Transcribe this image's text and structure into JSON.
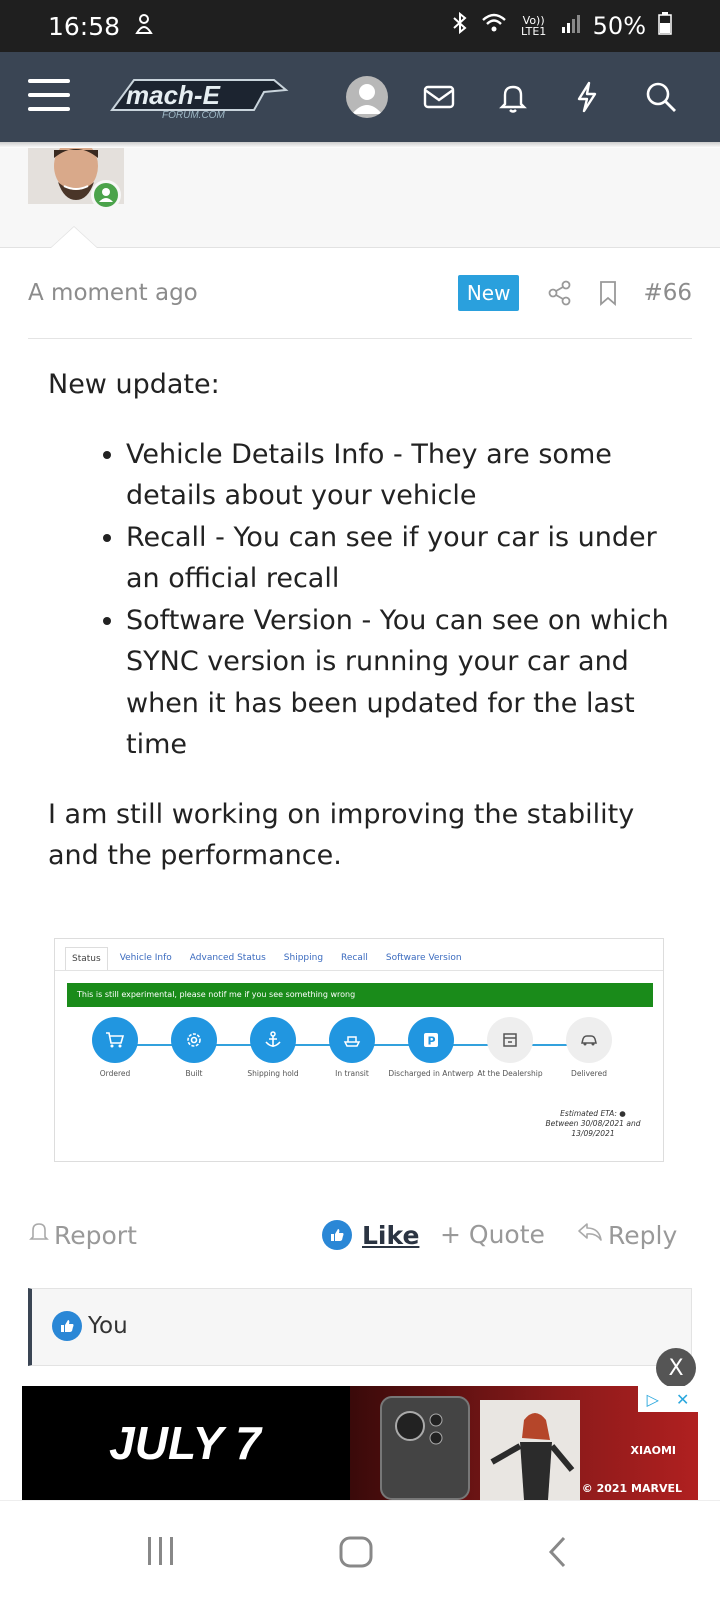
{
  "status_bar": {
    "time": "16:58",
    "battery": "50%",
    "volte": "Vo)) LTE1"
  },
  "header": {
    "logo_text": "mach-E",
    "logo_sub": "FORUM.COM"
  },
  "post": {
    "time": "A moment ago",
    "badge": "New",
    "number": "#66",
    "intro": "New update:",
    "bullets": [
      "Vehicle Details Info - They are some details about your vehicle",
      "Recall - You can see if your car is under an official recall",
      "Software Version - You can see on which SYNC version is running your car and when it has been updated for the last time"
    ],
    "closing": "I am still working on improving the stability and the performance."
  },
  "embed": {
    "tabs": [
      "Status",
      "Vehicle Info",
      "Advanced Status",
      "Shipping",
      "Recall",
      "Software Version"
    ],
    "banner": "This is still experimental, please notif me if you see something wrong",
    "steps": [
      "Ordered",
      "Built",
      "Shipping hold",
      "In transit",
      "Discharged in Antwerp",
      "At the Dealership",
      "Delivered"
    ],
    "eta_label": "Estimated ETA:",
    "eta_text": "Between 30/08/2021 and 13/09/2021"
  },
  "actions": {
    "report": "Report",
    "like": "Like",
    "quote": "+ Quote",
    "reply": "Reply"
  },
  "reactions": {
    "user": "You"
  },
  "ad": {
    "headline": "JULY 7",
    "brand": "XIAOMI",
    "copyright": "© 2021 MARVEL",
    "close": "X"
  }
}
